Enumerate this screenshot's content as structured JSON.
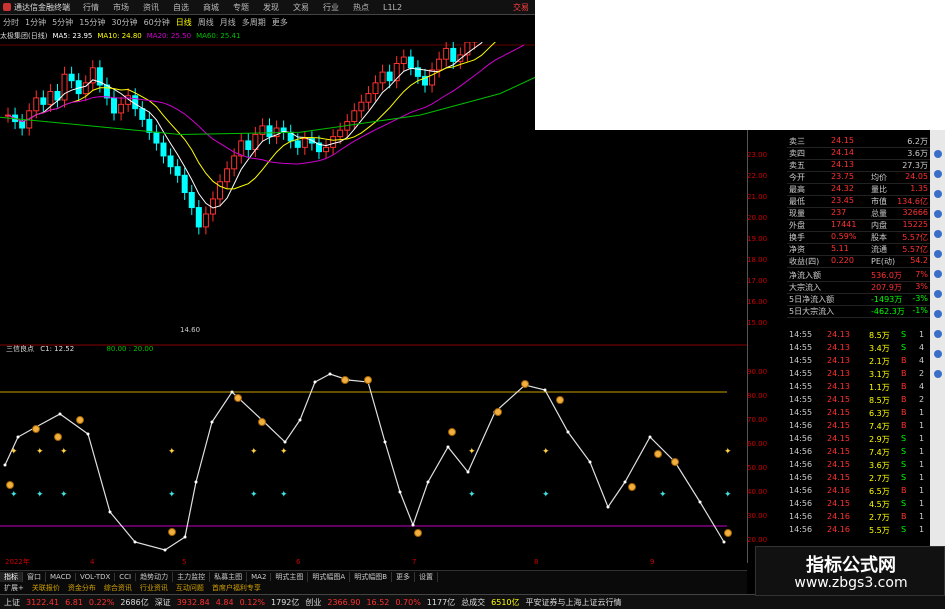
{
  "menubar": {
    "app_title": "通达信金融终端",
    "items": [
      "行情",
      "市场",
      "资讯",
      "自选",
      "商城",
      "专题",
      "发现",
      "文易",
      "行业",
      "热点",
      "L1L2"
    ],
    "trade": "交易"
  },
  "tabbar": {
    "items": [
      "分时",
      "1分钟",
      "5分钟",
      "15分钟",
      "30分钟",
      "60分钟",
      "日线",
      "周线",
      "月线",
      "多周期",
      "更多"
    ],
    "active": "日线"
  },
  "infobar": {
    "stock": "太极集团(日线)",
    "ma5": "MA5: 23.95",
    "ma10": "MA10: 24.80",
    "ma20": "MA20: 25.50",
    "ma60": "MA60: 25.41"
  },
  "price_axis": [
    "23.00",
    "22.00",
    "21.00",
    "20.00",
    "19.00",
    "18.00",
    "17.00",
    "16.00",
    "15.00"
  ],
  "price_low_label": "14.60",
  "indicator": {
    "label": "三信良点",
    "value": "C1: 12.52",
    "levels": "80.00 : 20.00",
    "axis": [
      "90.00",
      "80.00",
      "70.00",
      "60.00",
      "50.00",
      "40.00",
      "30.00",
      "20.00"
    ]
  },
  "date_labels": [
    "2022年",
    "4",
    "5",
    "6",
    "7",
    "8",
    "9"
  ],
  "quote": [
    {
      "l": "卖三",
      "v": "24.15",
      "r": "6.2万"
    },
    {
      "l": "卖四",
      "v": "24.14",
      "r": "3.6万"
    },
    {
      "l": "卖五",
      "v": "24.13",
      "r": "27.3万"
    },
    {
      "l": "今开",
      "v": "23.75",
      "r2l": "均价",
      "r": "24.05"
    },
    {
      "l": "最高",
      "v": "24.32",
      "r2l": "量比",
      "r": "1.35"
    },
    {
      "l": "最低",
      "v": "23.45",
      "r2l": "市值",
      "r": "134.6亿"
    },
    {
      "l": "现量",
      "v": "237",
      "r2l": "总量",
      "r": "32666"
    },
    {
      "l": "外盘",
      "v": "17441",
      "r2l": "内盘",
      "r": "15225"
    },
    {
      "l": "换手",
      "v": "0.59%",
      "r2l": "股本",
      "r": "5.57亿"
    },
    {
      "l": "净资",
      "v": "5.11",
      "r2l": "流通",
      "r": "5.57亿"
    },
    {
      "l": "收益(四)",
      "v": "0.220",
      "r2l": "PE(动)",
      "r": "54.2"
    }
  ],
  "flows": [
    {
      "l": "净流入额",
      "v": "536.0万",
      "p": "7%"
    },
    {
      "l": "大宗流入",
      "v": "207.9万",
      "p": "3%"
    },
    {
      "l": "5日净流入额",
      "v": "-1493万",
      "p": "-3%"
    },
    {
      "l": "5日大宗流入",
      "v": "-462.3万",
      "p": "-1%"
    }
  ],
  "trades": [
    {
      "t": "14:55",
      "p": "24.13",
      "v": "8.5万",
      "s": "S",
      "n": "1"
    },
    {
      "t": "14:55",
      "p": "24.13",
      "v": "3.4万",
      "s": "S",
      "n": "4"
    },
    {
      "t": "14:55",
      "p": "24.13",
      "v": "2.1万",
      "s": "B",
      "n": "4"
    },
    {
      "t": "14:55",
      "p": "24.13",
      "v": "3.1万",
      "s": "B",
      "n": "2"
    },
    {
      "t": "14:55",
      "p": "24.13",
      "v": "1.1万",
      "s": "B",
      "n": "4"
    },
    {
      "t": "14:55",
      "p": "24.15",
      "v": "8.5万",
      "s": "B",
      "n": "2"
    },
    {
      "t": "14:55",
      "p": "24.15",
      "v": "6.3万",
      "s": "B",
      "n": "1"
    },
    {
      "t": "14:56",
      "p": "24.15",
      "v": "7.4万",
      "s": "B",
      "n": "1"
    },
    {
      "t": "14:56",
      "p": "24.15",
      "v": "2.9万",
      "s": "S",
      "n": "1"
    },
    {
      "t": "14:56",
      "p": "24.15",
      "v": "7.4万",
      "s": "S",
      "n": "1"
    },
    {
      "t": "14:56",
      "p": "24.15",
      "v": "3.6万",
      "s": "S",
      "n": "1"
    },
    {
      "t": "14:56",
      "p": "24.15",
      "v": "2.7万",
      "s": "S",
      "n": "1"
    },
    {
      "t": "14:56",
      "p": "24.16",
      "v": "6.5万",
      "s": "B",
      "n": "1"
    },
    {
      "t": "14:56",
      "p": "24.15",
      "v": "4.5万",
      "s": "S",
      "n": "1"
    },
    {
      "t": "14:56",
      "p": "24.16",
      "v": "2.7万",
      "s": "B",
      "n": "1"
    },
    {
      "t": "14:56",
      "p": "24.16",
      "v": "5.5万",
      "s": "S",
      "n": "1"
    }
  ],
  "bottom_tabs": [
    "指标",
    "窗口",
    "MACD",
    "VOL-TDX",
    "CCI",
    "趋势动力",
    "主力监控",
    "私募主图",
    "MA2",
    "明式主图",
    "明式幅图A",
    "明式幅图B",
    "更多",
    "设置"
  ],
  "bottom_tabs2": [
    "扩展+",
    "关联报价",
    "资金分布",
    "综合资讯",
    "行业资讯",
    "互动问题",
    "首席户福利专享"
  ],
  "statusbar": {
    "sh_label": "上证",
    "sh_val": "3122.41",
    "sh_chg": "6.81",
    "sh_pct": "0.22%",
    "sh_amt": "2686亿",
    "sz_label": "深证",
    "sz_val": "3932.84",
    "sz_chg": "4.84",
    "sz_pct": "0.12%",
    "sz_amt": "1792亿",
    "cy_label": "创业",
    "cy_val": "2366.90",
    "cy_chg": "16.52",
    "cy_pct": "0.70%",
    "cy_amt": "1177亿",
    "total_label": "总成交",
    "total_val": "6510亿",
    "news": "平安证券与上海上证云行情"
  },
  "watermark": {
    "title": "指标公式网",
    "url": "www.zbgs3.com"
  },
  "colors": {
    "up": "#ff3030",
    "down": "#00ffff",
    "ma5": "#ffffff",
    "ma10": "#ffff00",
    "ma20": "#d000d0",
    "ma60": "#00c000",
    "line80": "#c8a000",
    "line20": "#c000c0"
  }
}
